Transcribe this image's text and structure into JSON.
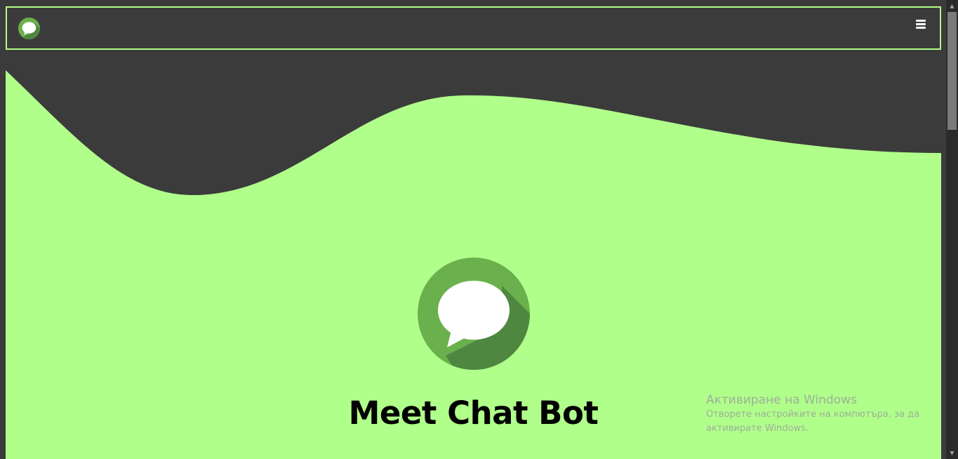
{
  "header": {
    "logo_icon": "chat-bubble-icon",
    "menu_icon": "hamburger-menu-icon"
  },
  "hero": {
    "title": "Meet Chat Bot",
    "logo_icon": "chat-bubble-icon"
  },
  "watermark": {
    "title": "Активиране на Windows",
    "line1": "Отворете настройките на компютъра, за да",
    "line2": "активирате Windows."
  },
  "colors": {
    "accent": "#b1ff8b",
    "background": "#3b3b3b",
    "logo_circle": "#6ab04c",
    "logo_shadow": "#4f8741",
    "title": "#000000"
  }
}
